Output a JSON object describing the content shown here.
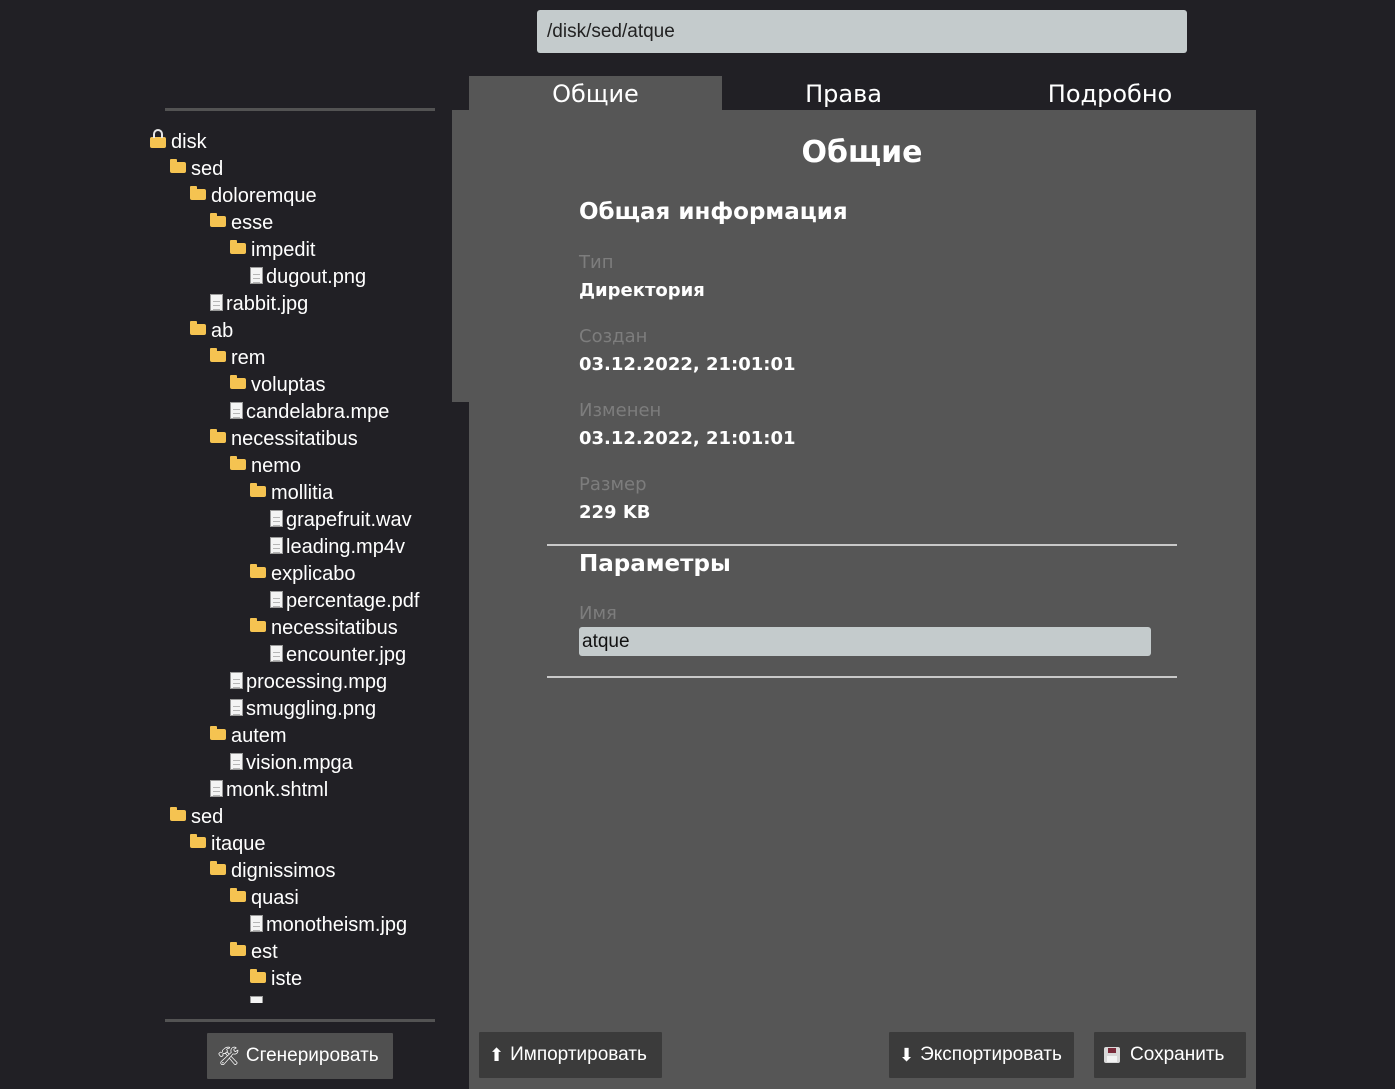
{
  "path": {
    "value": "/disk/sed/atque"
  },
  "tabs": [
    {
      "label": "Общие",
      "active": true
    },
    {
      "label": "Права",
      "active": false
    },
    {
      "label": "Подробно",
      "active": false
    }
  ],
  "panel": {
    "title": "Общие",
    "general_info": {
      "heading": "Общая информация",
      "fields": [
        {
          "label": "Тип",
          "value": "Директория"
        },
        {
          "label": "Создан",
          "value": "03.12.2022, 21:01:01"
        },
        {
          "label": "Изменен",
          "value": "03.12.2022, 21:01:01"
        },
        {
          "label": "Размер",
          "value": "229 KB"
        }
      ]
    },
    "params": {
      "heading": "Параметры",
      "name_label": "Имя",
      "name_value": "atque"
    }
  },
  "tree": [
    {
      "label": "disk",
      "type": "root",
      "depth": 0
    },
    {
      "label": "sed",
      "type": "folder",
      "depth": 1
    },
    {
      "label": "doloremque",
      "type": "folder",
      "depth": 2
    },
    {
      "label": "esse",
      "type": "folder",
      "depth": 3
    },
    {
      "label": "impedit",
      "type": "folder",
      "depth": 4
    },
    {
      "label": "dugout.png",
      "type": "file",
      "depth": 5
    },
    {
      "label": "rabbit.jpg",
      "type": "file",
      "depth": 3
    },
    {
      "label": "ab",
      "type": "folder",
      "depth": 2
    },
    {
      "label": "rem",
      "type": "folder",
      "depth": 3
    },
    {
      "label": "voluptas",
      "type": "folder",
      "depth": 4
    },
    {
      "label": "candelabra.mpe",
      "type": "file",
      "depth": 4
    },
    {
      "label": "necessitatibus",
      "type": "folder",
      "depth": 3
    },
    {
      "label": "nemo",
      "type": "folder",
      "depth": 4
    },
    {
      "label": "mollitia",
      "type": "folder",
      "depth": 5
    },
    {
      "label": "grapefruit.wav",
      "type": "file",
      "depth": 6
    },
    {
      "label": "leading.mp4v",
      "type": "file",
      "depth": 6
    },
    {
      "label": "explicabo",
      "type": "folder",
      "depth": 5
    },
    {
      "label": "percentage.pdf",
      "type": "file",
      "depth": 6
    },
    {
      "label": "necessitatibus",
      "type": "folder",
      "depth": 5
    },
    {
      "label": "encounter.jpg",
      "type": "file",
      "depth": 6
    },
    {
      "label": "processing.mpg",
      "type": "file",
      "depth": 4
    },
    {
      "label": "smuggling.png",
      "type": "file",
      "depth": 4
    },
    {
      "label": "autem",
      "type": "folder",
      "depth": 3
    },
    {
      "label": "vision.mpga",
      "type": "file",
      "depth": 4
    },
    {
      "label": "monk.shtml",
      "type": "file",
      "depth": 3
    },
    {
      "label": "sed",
      "type": "folder",
      "depth": 1
    },
    {
      "label": "itaque",
      "type": "folder",
      "depth": 2
    },
    {
      "label": "dignissimos",
      "type": "folder",
      "depth": 3
    },
    {
      "label": "quasi",
      "type": "folder",
      "depth": 4
    },
    {
      "label": "monotheism.jpg",
      "type": "file",
      "depth": 5
    },
    {
      "label": "est",
      "type": "folder",
      "depth": 4
    },
    {
      "label": "iste",
      "type": "folder",
      "depth": 5
    },
    {
      "label": "",
      "type": "file",
      "depth": 5
    }
  ],
  "buttons": {
    "generate": "Сгенерировать",
    "import": "Импортировать",
    "export": "Экспортировать",
    "save": "Сохранить"
  }
}
